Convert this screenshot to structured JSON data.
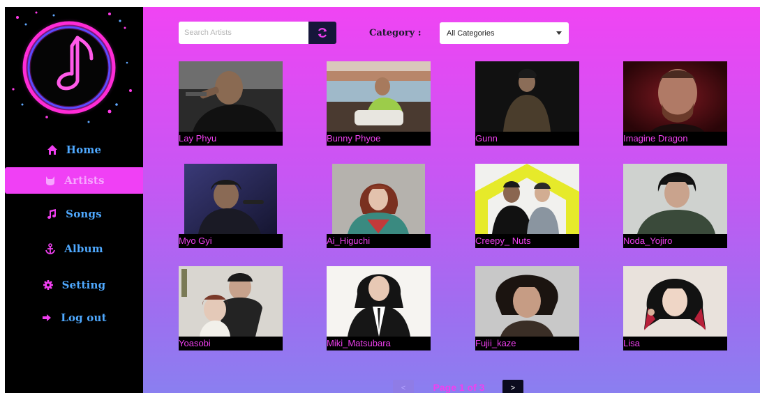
{
  "sidebar": {
    "items": [
      {
        "label": "Home",
        "icon": "home-icon"
      },
      {
        "label": "Artists",
        "icon": "cat-icon"
      },
      {
        "label": "Songs",
        "icon": "music-icon"
      },
      {
        "label": "Album",
        "icon": "anchor-icon"
      },
      {
        "label": "Setting",
        "icon": "gear-icon"
      },
      {
        "label": "Log out",
        "icon": "logout-icon"
      }
    ],
    "active_index": 1
  },
  "search": {
    "placeholder": "Search Artists",
    "value": ""
  },
  "filter": {
    "label": "Category :",
    "selected": "All Categories"
  },
  "artists": [
    {
      "name": "Lay Phyu"
    },
    {
      "name": "Bunny Phyoe"
    },
    {
      "name": "Gunn"
    },
    {
      "name": "Imagine Dragon"
    },
    {
      "name": "Myo Gyi"
    },
    {
      "name": "Ai_Higuchi"
    },
    {
      "name": "Creepy_ Nuts"
    },
    {
      "name": "Noda_Yojiro"
    },
    {
      "name": "Yoasobi"
    },
    {
      "name": "Miki_Matsubara"
    },
    {
      "name": "Fujii_kaze"
    },
    {
      "name": "Lisa"
    }
  ],
  "pagination": {
    "prev": "<",
    "next": ">",
    "text": "Page 1 of 3"
  },
  "colors": {
    "accent": "#f03ff0",
    "nav_text": "#4fa9ff",
    "sidebar_bg": "#000000"
  }
}
